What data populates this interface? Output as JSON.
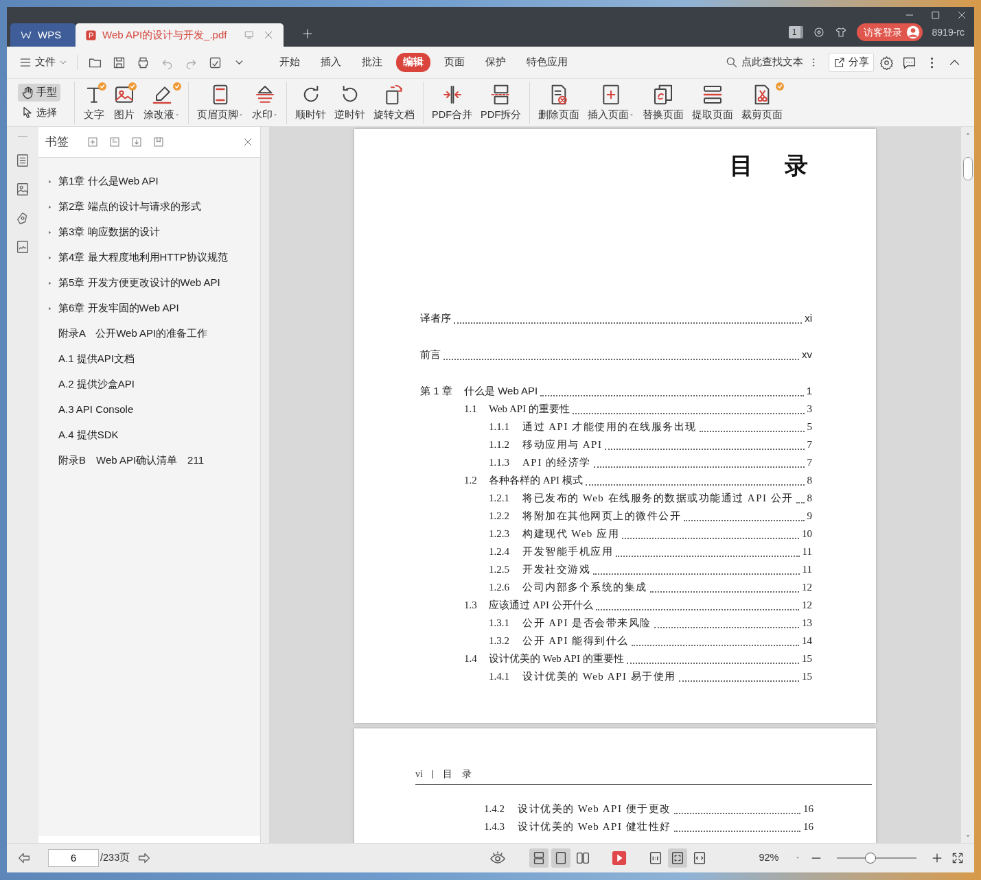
{
  "tabs": [
    {
      "label": "WPS",
      "kind": "home",
      "selected": false
    },
    {
      "label": "Web API的设计与开发_.pdf",
      "kind": "document",
      "selected": true
    }
  ],
  "title_bar": {
    "window_count": "1",
    "login_button": "访客登录",
    "user_id": "8919-rc"
  },
  "menu": {
    "file_label": "文件",
    "tabs": [
      {
        "label": "开始",
        "selected": false
      },
      {
        "label": "插入",
        "selected": false
      },
      {
        "label": "批注",
        "selected": false
      },
      {
        "label": "编辑",
        "selected": true
      },
      {
        "label": "页面",
        "selected": false
      },
      {
        "label": "保护",
        "selected": false
      },
      {
        "label": "特色应用",
        "selected": false
      }
    ],
    "search_label": "点此查找文本",
    "share_label": "分享"
  },
  "ribbon": {
    "modes": [
      {
        "label": "手型",
        "selected": true
      },
      {
        "label": "选择",
        "selected": false
      }
    ],
    "tool_groups": [
      [
        {
          "label": "文字",
          "dropdown": false,
          "badge": true
        },
        {
          "label": "图片",
          "dropdown": false,
          "badge": true
        },
        {
          "label": "涂改液",
          "dropdown": true,
          "badge": true
        }
      ],
      [
        {
          "label": "页眉页脚",
          "dropdown": true,
          "badge": false
        },
        {
          "label": "水印",
          "dropdown": true,
          "badge": false
        }
      ],
      [
        {
          "label": "顺时针",
          "dropdown": false,
          "badge": false
        },
        {
          "label": "逆时针",
          "dropdown": false,
          "badge": false
        },
        {
          "label": "旋转文档",
          "dropdown": false,
          "badge": false
        }
      ],
      [
        {
          "label": "PDF合并",
          "dropdown": false,
          "badge": false
        },
        {
          "label": "PDF拆分",
          "dropdown": false,
          "badge": false
        }
      ],
      [
        {
          "label": "删除页面",
          "dropdown": false,
          "badge": false
        },
        {
          "label": "插入页面",
          "dropdown": true,
          "badge": false
        },
        {
          "label": "替换页面",
          "dropdown": false,
          "badge": false
        },
        {
          "label": "提取页面",
          "dropdown": false,
          "badge": false
        },
        {
          "label": "裁剪页面",
          "dropdown": false,
          "badge": true
        }
      ]
    ]
  },
  "bookmarks": {
    "title": "书签",
    "items": [
      {
        "label": "第1章 什么是Web API",
        "expandable": true
      },
      {
        "label": "第2章 端点的设计与请求的形式",
        "expandable": true
      },
      {
        "label": "第3章 响应数据的设计",
        "expandable": true
      },
      {
        "label": "第4章 最大程度地利用HTTP协议规范",
        "expandable": true
      },
      {
        "label": "第5章 开发方便更改设计的Web API",
        "expandable": true
      },
      {
        "label": "第6章 开发牢固的Web API",
        "expandable": true
      },
      {
        "label": "附录A　公开Web API的准备工作",
        "expandable": false
      },
      {
        "label": "A.1 提供API文档",
        "expandable": false
      },
      {
        "label": "A.2 提供沙盒API",
        "expandable": false
      },
      {
        "label": "A.3 API Console",
        "expandable": false
      },
      {
        "label": "A.4 提供SDK",
        "expandable": false
      },
      {
        "label": "附录B　Web API确认清单　211",
        "expandable": false
      }
    ]
  },
  "pages": [
    {
      "heading": "目　录",
      "entries": [
        {
          "kind": "front",
          "title": "译者序",
          "page": "xi"
        },
        {
          "kind": "front",
          "title": "前言",
          "page": "xv"
        },
        {
          "kind": "chapter",
          "number": "第 1 章",
          "title": "什么是 Web API",
          "page": "1",
          "children": [
            {
              "kind": "section",
              "number": "1.1",
              "title": "Web API 的重要性",
              "page": "3",
              "children": [
                {
                  "kind": "subsection",
                  "number": "1.1.1",
                  "title": "通过 API 才能使用的在线服务出现",
                  "page": "5"
                },
                {
                  "kind": "subsection",
                  "number": "1.1.2",
                  "title": "移动应用与 API",
                  "page": "7"
                },
                {
                  "kind": "subsection",
                  "number": "1.1.3",
                  "title": "API 的经济学",
                  "page": "7"
                }
              ]
            },
            {
              "kind": "section",
              "number": "1.2",
              "title": "各种各样的 API 模式",
              "page": "8",
              "children": [
                {
                  "kind": "subsection",
                  "number": "1.2.1",
                  "title": "将已发布的 Web 在线服务的数据或功能通过 API 公开",
                  "page": "8"
                },
                {
                  "kind": "subsection",
                  "number": "1.2.2",
                  "title": "将附加在其他网页上的微件公开",
                  "page": "9"
                },
                {
                  "kind": "subsection",
                  "number": "1.2.3",
                  "title": "构建现代 Web 应用",
                  "page": "10"
                },
                {
                  "kind": "subsection",
                  "number": "1.2.4",
                  "title": "开发智能手机应用",
                  "page": "11"
                },
                {
                  "kind": "subsection",
                  "number": "1.2.5",
                  "title": "开发社交游戏",
                  "page": "11"
                },
                {
                  "kind": "subsection",
                  "number": "1.2.6",
                  "title": "公司内部多个系统的集成",
                  "page": "12"
                }
              ]
            },
            {
              "kind": "section",
              "number": "1.3",
              "title": "应该通过 API 公开什么",
              "page": "12",
              "children": [
                {
                  "kind": "subsection",
                  "number": "1.3.1",
                  "title": "公开 API 是否会带来风险",
                  "page": "13"
                },
                {
                  "kind": "subsection",
                  "number": "1.3.2",
                  "title": "公开 API 能得到什么",
                  "page": "14"
                }
              ]
            },
            {
              "kind": "section",
              "number": "1.4",
              "title": "设计优美的 Web API 的重要性",
              "page": "15",
              "children": [
                {
                  "kind": "subsection",
                  "number": "1.4.1",
                  "title": "设计优美的 Web API 易于使用",
                  "page": "15"
                }
              ]
            }
          ]
        }
      ]
    },
    {
      "header": {
        "folio": "vi",
        "title": "目　录"
      },
      "entries": [
        {
          "kind": "subsection",
          "number": "1.4.2",
          "title": "设计优美的 Web API 便于更改",
          "page": "16"
        },
        {
          "kind": "subsection",
          "number": "1.4.3",
          "title": "设计优美的 Web API 健壮性好",
          "page": "16"
        }
      ]
    }
  ],
  "status_bar": {
    "page_value": "6",
    "page_total": "/233页",
    "view_modes": [
      {
        "selected": true
      },
      {
        "selected": true
      },
      {
        "selected": false
      }
    ],
    "fit_modes": [
      {
        "selected": false
      },
      {
        "selected": true
      },
      {
        "selected": false
      }
    ],
    "zoom": "92%",
    "zoom_slider": {
      "level": 0.42
    }
  }
}
